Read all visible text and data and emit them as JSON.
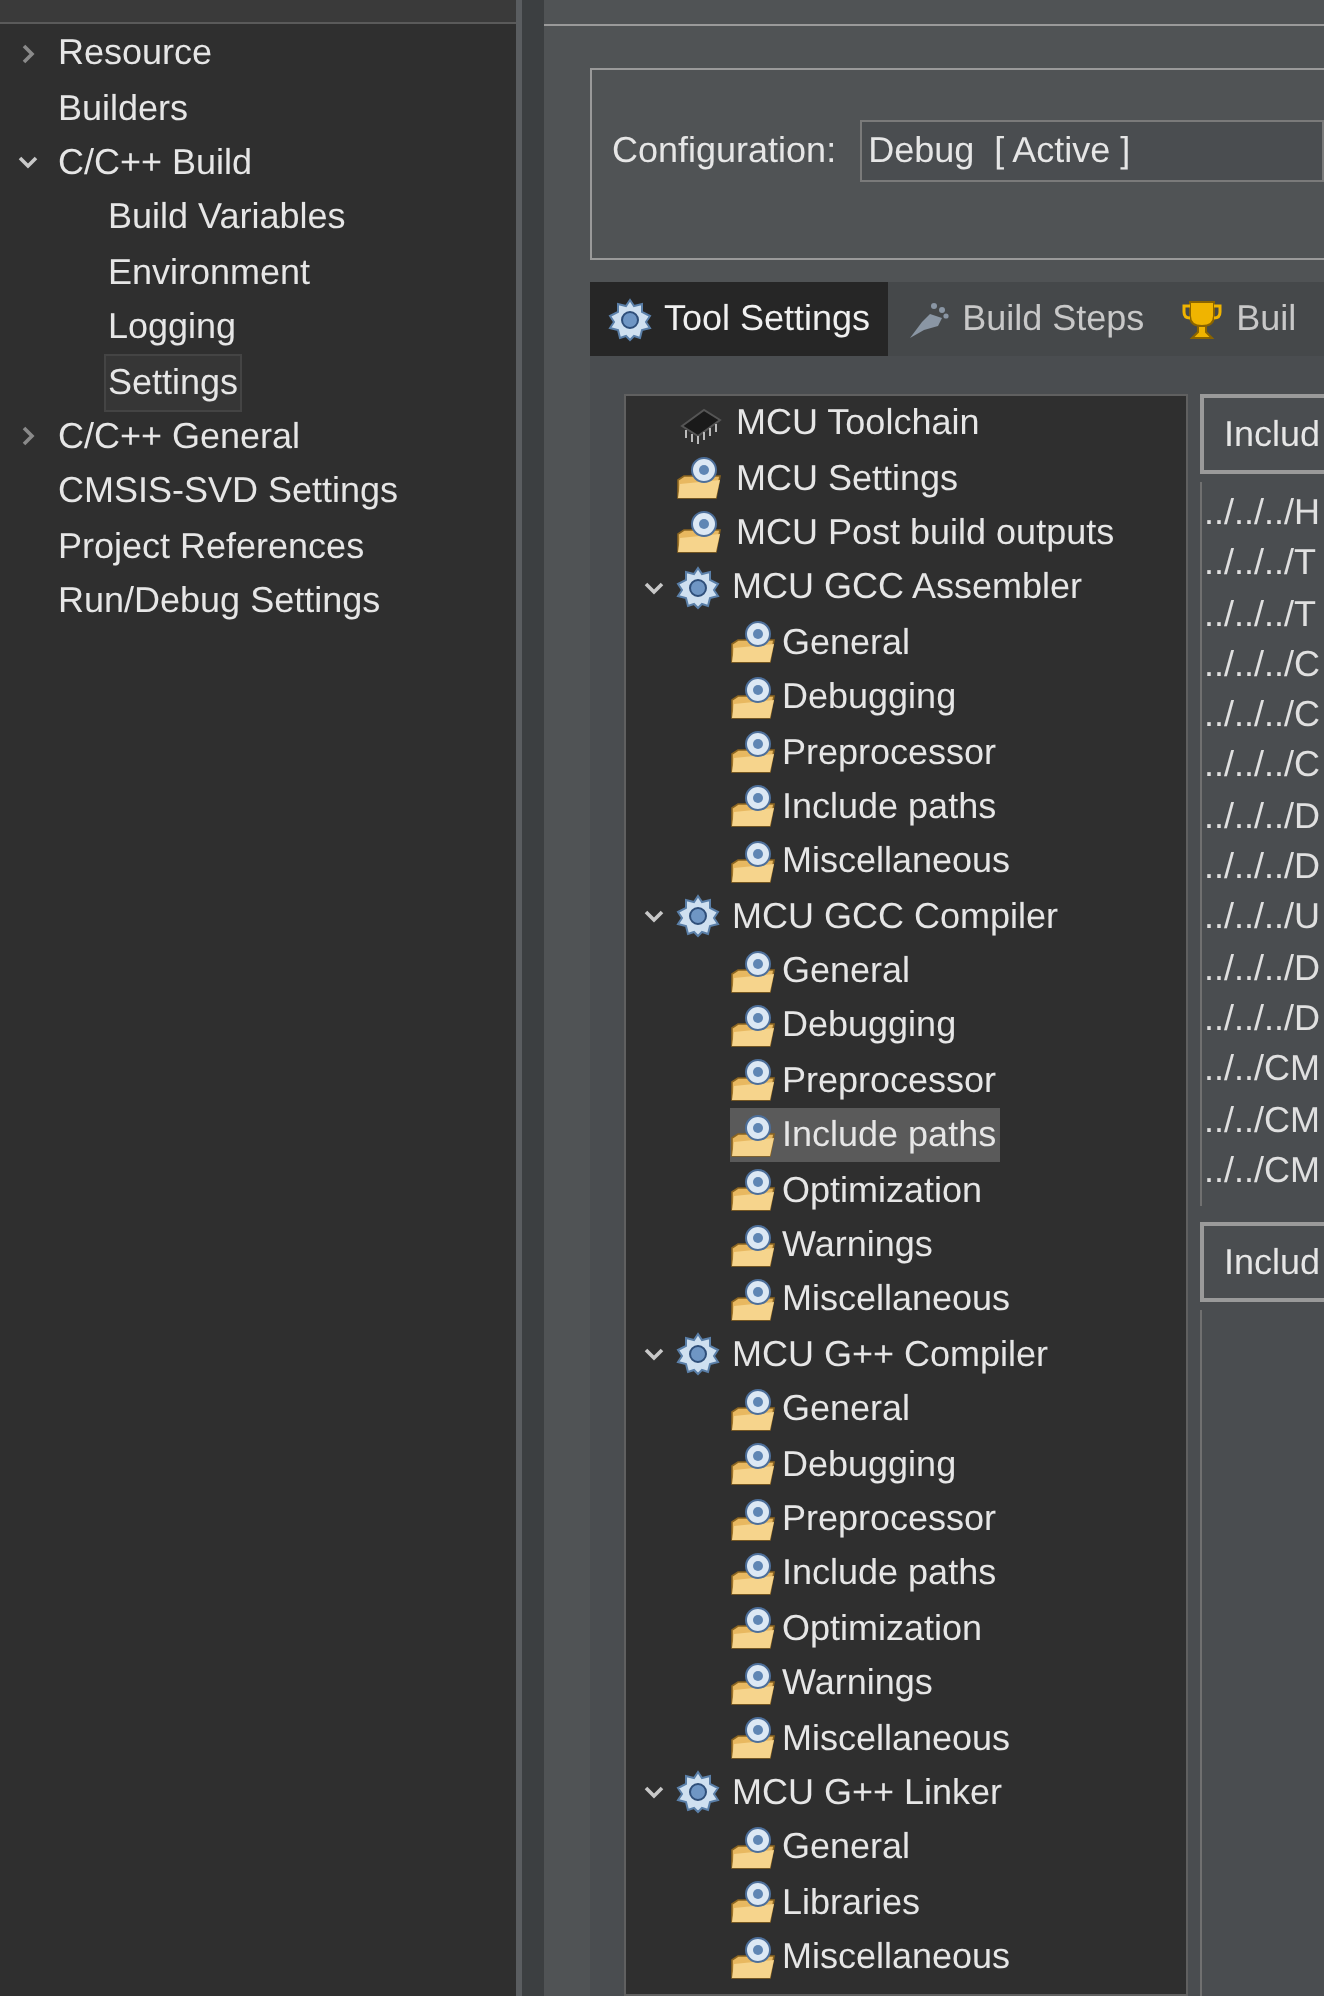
{
  "sidebar": {
    "items": [
      {
        "label": "Resource",
        "expanded": false,
        "selected": false
      },
      {
        "label": "Builders",
        "selected": false
      },
      {
        "label": "C/C++ Build",
        "expanded": true,
        "selected": false,
        "children": [
          {
            "label": "Build Variables",
            "selected": false
          },
          {
            "label": "Environment",
            "selected": false
          },
          {
            "label": "Logging",
            "selected": false
          },
          {
            "label": "Settings",
            "selected": true
          }
        ]
      },
      {
        "label": "C/C++ General",
        "expanded": false,
        "selected": false
      },
      {
        "label": "CMSIS-SVD Settings",
        "selected": false
      },
      {
        "label": "Project References",
        "selected": false
      },
      {
        "label": "Run/Debug Settings",
        "selected": false
      }
    ]
  },
  "configuration": {
    "label": "Configuration:",
    "value": "Debug  [ Active ]"
  },
  "tabs": [
    {
      "label": "Tool Settings",
      "kind": "gear",
      "selected": true
    },
    {
      "label": "Build Steps",
      "kind": "foot",
      "selected": false
    },
    {
      "label": "Buil",
      "kind": "trophy",
      "selected": false
    }
  ],
  "tool_tree": [
    {
      "label": "MCU Toolchain",
      "kind": "chip",
      "selected": false
    },
    {
      "label": "MCU Settings",
      "kind": "folder",
      "selected": false
    },
    {
      "label": "MCU Post build outputs",
      "kind": "folder",
      "selected": false
    },
    {
      "label": "MCU GCC Assembler",
      "kind": "gear",
      "expanded": true,
      "selected": false,
      "children": [
        {
          "label": "General",
          "selected": false
        },
        {
          "label": "Debugging",
          "selected": false
        },
        {
          "label": "Preprocessor",
          "selected": false
        },
        {
          "label": "Include paths",
          "selected": false
        },
        {
          "label": "Miscellaneous",
          "selected": false
        }
      ]
    },
    {
      "label": "MCU GCC Compiler",
      "kind": "gear",
      "expanded": true,
      "selected": false,
      "children": [
        {
          "label": "General",
          "selected": false
        },
        {
          "label": "Debugging",
          "selected": false
        },
        {
          "label": "Preprocessor",
          "selected": false
        },
        {
          "label": "Include paths",
          "selected": true
        },
        {
          "label": "Optimization",
          "selected": false
        },
        {
          "label": "Warnings",
          "selected": false
        },
        {
          "label": "Miscellaneous",
          "selected": false
        }
      ]
    },
    {
      "label": "MCU G++ Compiler",
      "kind": "gear",
      "expanded": true,
      "selected": false,
      "children": [
        {
          "label": "General",
          "selected": false
        },
        {
          "label": "Debugging",
          "selected": false
        },
        {
          "label": "Preprocessor",
          "selected": false
        },
        {
          "label": "Include paths",
          "selected": false
        },
        {
          "label": "Optimization",
          "selected": false
        },
        {
          "label": "Warnings",
          "selected": false
        },
        {
          "label": "Miscellaneous",
          "selected": false
        }
      ]
    },
    {
      "label": "MCU G++ Linker",
      "kind": "gear",
      "expanded": true,
      "selected": false,
      "children": [
        {
          "label": "General",
          "selected": false
        },
        {
          "label": "Libraries",
          "selected": false
        },
        {
          "label": "Miscellaneous",
          "selected": false
        }
      ]
    }
  ],
  "include_paths": {
    "header": "Includ",
    "paths": [
      "../../../H",
      "../../../T",
      "../../../T",
      "../../../C",
      "../../../C",
      "../../../C",
      "../../../D",
      "../../../D",
      "../../../U",
      "../../../D",
      "../../../D",
      "../../CM",
      "../../CM",
      "../../CM"
    ]
  },
  "include_files": {
    "header": "Includ"
  }
}
